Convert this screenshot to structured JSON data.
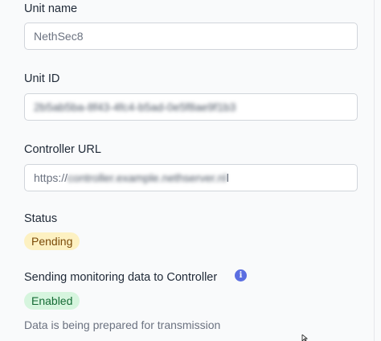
{
  "unit_name": {
    "label": "Unit name",
    "value": "NethSec8"
  },
  "unit_id": {
    "label": "Unit ID",
    "value": "2b5ab5ba-8f43-4fc4-b5ad-0e5f8ae9f1b3"
  },
  "controller_url": {
    "label": "Controller URL",
    "prefix": "https://",
    "value_hidden": "controller.example.nethserver.nl",
    "suffix": "l"
  },
  "status": {
    "label": "Status",
    "badge": "Pending"
  },
  "monitoring": {
    "label": "Sending monitoring data to Controller",
    "info_icon": "info-icon",
    "badge": "Enabled",
    "help": "Data is being prepared for transmission"
  },
  "colors": {
    "pending_bg": "#fdf1c2",
    "enabled_bg": "#d6f5de",
    "info_icon": "#5b6ee1"
  }
}
